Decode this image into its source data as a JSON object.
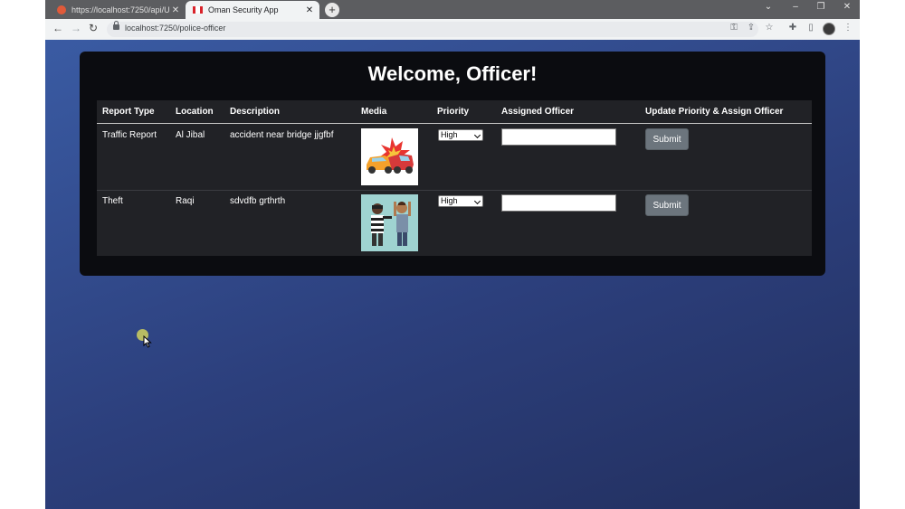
{
  "browser": {
    "tabs": [
      {
        "title": "https://localhost:7250/api/User/",
        "active": false
      },
      {
        "title": "Oman Security App",
        "active": true
      }
    ],
    "url": "localhost:7250/police-officer"
  },
  "page": {
    "heading": "Welcome, Officer!",
    "columns": [
      "Report Type",
      "Location",
      "Description",
      "Media",
      "Priority",
      "Assigned Officer",
      "Update Priority & Assign Officer"
    ],
    "rows": [
      {
        "report_type": "Traffic Report",
        "location": "Al Jibal",
        "description": "accident near bridge jjgfbf",
        "media_icon": "car-accident-image",
        "priority": "High",
        "assigned_officer": "",
        "submit_label": "Submit"
      },
      {
        "report_type": "Theft",
        "location": "Raqi",
        "description": "sdvdfb grthrth",
        "media_icon": "theft-image",
        "priority": "High",
        "assigned_officer": "",
        "submit_label": "Submit"
      }
    ]
  },
  "colors": {
    "card": "#0b0c10",
    "table": "#212226",
    "button": "#6c757d",
    "background": "#2c3f7c"
  }
}
